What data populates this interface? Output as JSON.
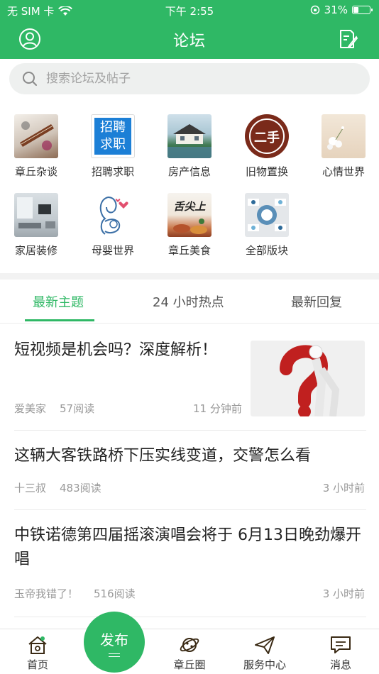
{
  "status_bar": {
    "carrier": "无 SIM 卡",
    "time": "下午 2:55",
    "battery": "31%",
    "battery_level": 0.31
  },
  "header": {
    "title": "论坛"
  },
  "search": {
    "placeholder": "搜索论坛及帖子"
  },
  "categories": [
    {
      "label": "章丘杂谈",
      "icon": "guzheng-photo"
    },
    {
      "label": "招聘求职",
      "icon": "recruitment-badge",
      "badge_line1": "招聘",
      "badge_line2": "求职"
    },
    {
      "label": "房产信息",
      "icon": "house-photo"
    },
    {
      "label": "旧物置换",
      "icon": "secondhand-badge",
      "badge_text": "二手"
    },
    {
      "label": "心情世界",
      "icon": "flowers-photo"
    },
    {
      "label": "家居装修",
      "icon": "interior-photo"
    },
    {
      "label": "母婴世界",
      "icon": "mother-baby-illustration"
    },
    {
      "label": "章丘美食",
      "icon": "food-photo",
      "overlay_text": "舌尖上"
    },
    {
      "label": "全部版块",
      "icon": "all-sections-grid"
    }
  ],
  "tabs": [
    {
      "label": "最新主题",
      "active": true
    },
    {
      "label": "24 小时热点",
      "active": false
    },
    {
      "label": "最新回复",
      "active": false
    }
  ],
  "posts": [
    {
      "title": "短视频是机会吗？深度解析！",
      "author": "爱美家",
      "reads": "57阅读",
      "time": "11 分钟前",
      "has_thumbnail": true,
      "thumbnail_icon": "question-mark-figure"
    },
    {
      "title": "这辆大客铁路桥下压实线变道，交警怎么看",
      "author": "十三叔",
      "reads": "483阅读",
      "time": "3 小时前",
      "has_thumbnail": false
    },
    {
      "title": "中铁诺德第四届摇滚演唱会将于 6月13日晚劲爆开唱",
      "author": "玉帝我错了！",
      "reads": "516阅读",
      "time": "3 小时前",
      "has_thumbnail": false
    }
  ],
  "tabbar": {
    "home": "首页",
    "publish": "发布",
    "circle": "章丘圈",
    "service": "服务中心",
    "messages": "消息"
  },
  "colors": {
    "brand_green": "#2fb865",
    "text_dark": "#222222",
    "text_meta": "#999999"
  }
}
